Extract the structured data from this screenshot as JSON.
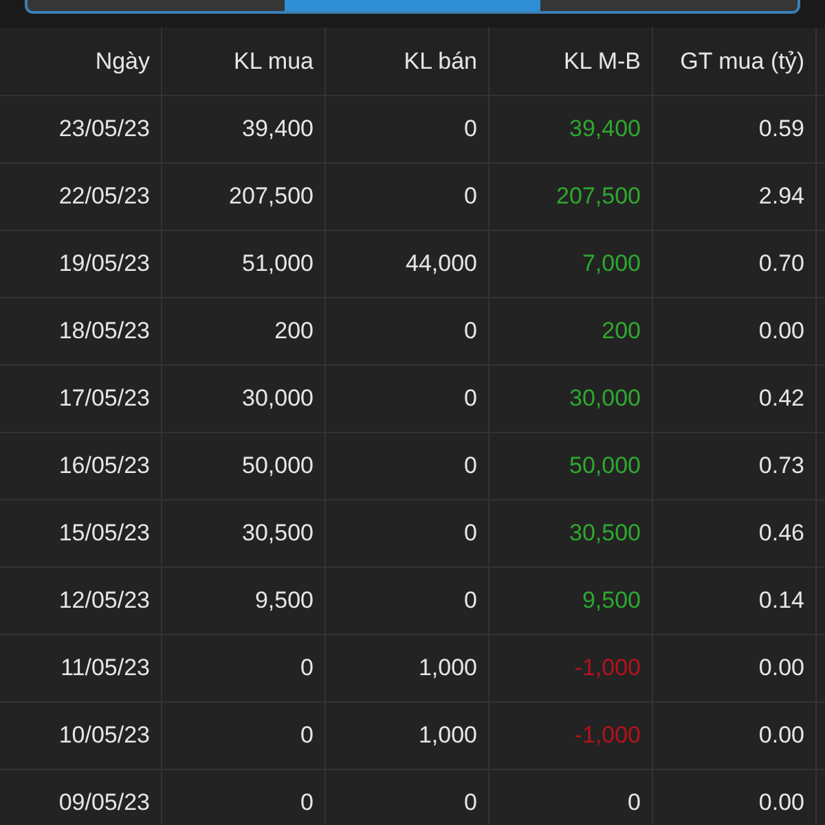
{
  "segments": [
    {
      "selected": false
    },
    {
      "selected": true
    },
    {
      "selected": false
    }
  ],
  "table": {
    "columns": [
      "Ngày",
      "KL mua",
      "KL bán",
      "KL M-B",
      "GT mua (tỷ)"
    ],
    "rows": [
      {
        "date": "23/05/23",
        "buy": "39,400",
        "sell": "0",
        "net": "39,400",
        "color": "#2ea82e",
        "value": "0.59"
      },
      {
        "date": "22/05/23",
        "buy": "207,500",
        "sell": "0",
        "net": "207,500",
        "color": "#2ea82e",
        "value": "2.94"
      },
      {
        "date": "19/05/23",
        "buy": "51,000",
        "sell": "44,000",
        "net": "7,000",
        "color": "#2ea82e",
        "value": "0.70"
      },
      {
        "date": "18/05/23",
        "buy": "200",
        "sell": "0",
        "net": "200",
        "color": "#2ea82e",
        "value": "0.00"
      },
      {
        "date": "17/05/23",
        "buy": "30,000",
        "sell": "0",
        "net": "30,000",
        "color": "#2ea82e",
        "value": "0.42"
      },
      {
        "date": "16/05/23",
        "buy": "50,000",
        "sell": "0",
        "net": "50,000",
        "color": "#2ea82e",
        "value": "0.73"
      },
      {
        "date": "15/05/23",
        "buy": "30,500",
        "sell": "0",
        "net": "30,500",
        "color": "#2ea82e",
        "value": "0.46"
      },
      {
        "date": "12/05/23",
        "buy": "9,500",
        "sell": "0",
        "net": "9,500",
        "color": "#2ea82e",
        "value": "0.14"
      },
      {
        "date": "11/05/23",
        "buy": "0",
        "sell": "1,000",
        "net": "-1,000",
        "color": "#b3121b",
        "value": "0.00"
      },
      {
        "date": "10/05/23",
        "buy": "0",
        "sell": "1,000",
        "net": "-1,000",
        "color": "#b3121b",
        "value": "0.00"
      },
      {
        "date": "09/05/23",
        "buy": "0",
        "sell": "0",
        "net": "0",
        "color": "#e6e6e6",
        "value": "0.00"
      }
    ]
  }
}
